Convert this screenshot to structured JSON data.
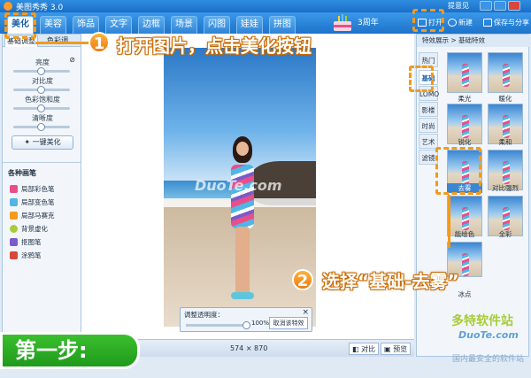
{
  "window": {
    "title": "美图秀秀 3.0",
    "feedback": "提意见"
  },
  "tabs": [
    "美化",
    "美容",
    "饰品",
    "文字",
    "边框",
    "场景",
    "闪图",
    "娃娃",
    "拼图"
  ],
  "anniversary": "3周年",
  "toolbar": {
    "open": "打开",
    "new": "新建",
    "save": "保存与分享"
  },
  "left": {
    "subtab1": "基础调整",
    "subtab2": "色彩调",
    "sliders": [
      "亮度",
      "对比度",
      "色彩饱和度",
      "清晰度"
    ],
    "one_click": "一键美化",
    "brushes_title": "各种画笔",
    "brushes": [
      "局部彩色笔",
      "局部变色笔",
      "局部马赛克",
      "背景虚化",
      "抠图笔",
      "涂鸦笔"
    ]
  },
  "canvas": {
    "watermark": "DuoTe.com",
    "popup_label": "调整透明度：",
    "popup_pct": "100%",
    "popup_cancel": "取消该特效"
  },
  "status": {
    "dims": "574 × 870",
    "compare": "对比",
    "preview": "预览"
  },
  "right": {
    "header": "特效展示 > 基础特效",
    "categories": [
      "热门",
      "基础",
      "LOMO",
      "影楼",
      "时尚",
      "艺术",
      "滤镜"
    ],
    "effects": [
      "",
      "",
      "柔光",
      "暖化",
      "锐化",
      "去雾",
      "对比强烈",
      "",
      "",
      "",
      "",
      ""
    ],
    "effects_row2": [
      "锐化",
      "柔和"
    ],
    "effects_row3": [
      "去雾",
      "对比强烈"
    ],
    "effects_row4": [
      "能绘色",
      "全彩"
    ],
    "effects_row5": [
      "冰点"
    ]
  },
  "callouts": {
    "step1_num": "1",
    "step1_text": "打开图片，点击美化按钮",
    "step2_num": "2",
    "step2_text": "选择“基础-去雾”",
    "banner": "第一步:"
  },
  "branding": {
    "site_cn": "多特软件站",
    "site": "DuoTe.com",
    "slogan": "国内最安全的软件站"
  }
}
